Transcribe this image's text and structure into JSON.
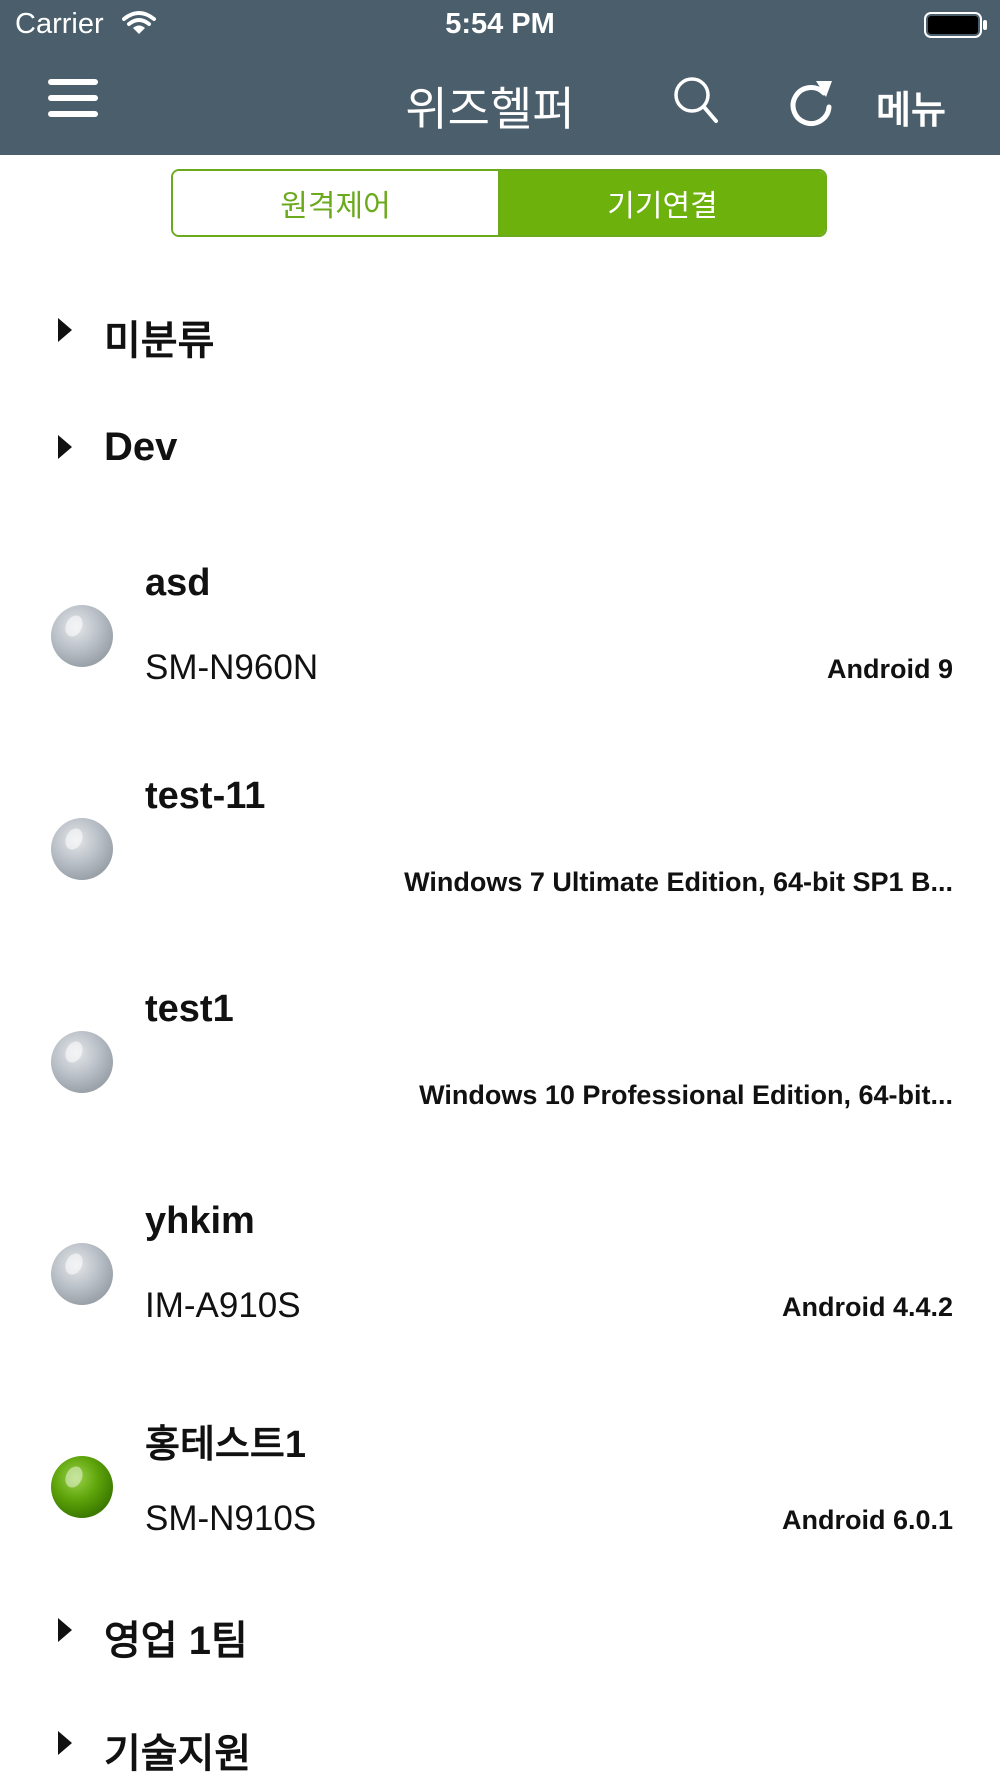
{
  "status_bar": {
    "carrier": "Carrier",
    "time": "5:54 PM"
  },
  "nav": {
    "title": "위즈헬퍼",
    "menu_label": "메뉴"
  },
  "tabs": [
    {
      "label": "원격제어",
      "selected": false
    },
    {
      "label": "기기연결",
      "selected": true
    }
  ],
  "groups": [
    {
      "label": "미분류"
    },
    {
      "label": "Dev"
    },
    {
      "label": "영업 1팀"
    },
    {
      "label": "기술지원"
    }
  ],
  "devices": [
    {
      "name": "asd",
      "model": "SM-N960N",
      "os": "Android 9",
      "status": "offline"
    },
    {
      "name": "test-11",
      "model": "",
      "os": "Windows 7 Ultimate Edition, 64-bit SP1 B...",
      "status": "offline"
    },
    {
      "name": "test1",
      "model": "",
      "os": "Windows 10 Professional Edition, 64-bit...",
      "status": "offline"
    },
    {
      "name": "yhkim",
      "model": "IM-A910S",
      "os": "Android 4.4.2",
      "status": "offline"
    },
    {
      "name": "홍테스트1",
      "model": "SM-N910S",
      "os": "Android 6.0.1",
      "status": "online"
    }
  ],
  "colors": {
    "header_bg": "#4a5e6b",
    "accent_green": "#6db20c",
    "offline_gray": "#b8bec6",
    "online_green": "#5ea40a"
  },
  "icons": [
    "hamburger-icon",
    "search-icon",
    "refresh-icon",
    "wifi-icon",
    "battery-icon",
    "expand-triangle-icon",
    "status-led-icon"
  ]
}
